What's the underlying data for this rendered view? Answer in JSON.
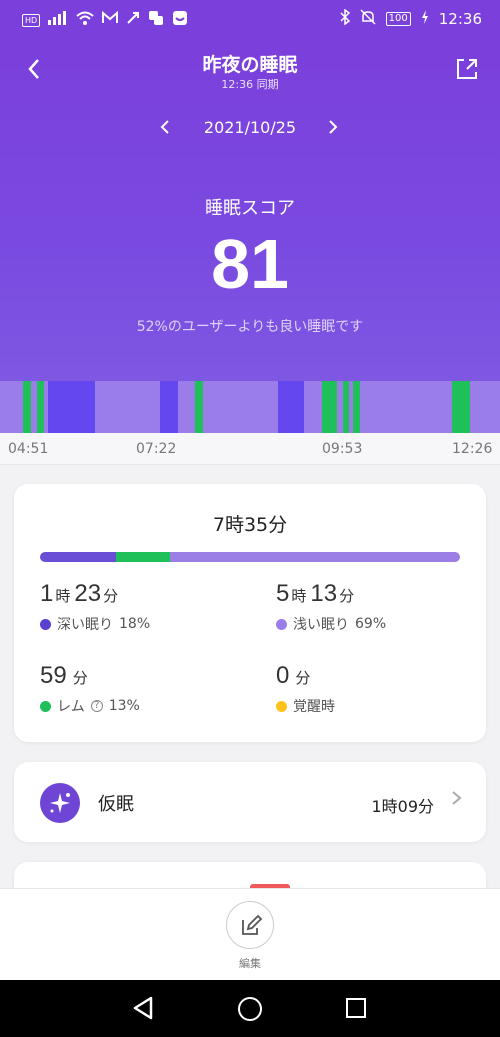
{
  "status_bar": {
    "hd": "HD",
    "battery": "100",
    "time": "12:36"
  },
  "header": {
    "title": "昨夜の睡眠",
    "sync": "12:36 同期",
    "date": "2021/10/25",
    "score_label": "睡眠スコア",
    "score": "81",
    "score_sub": "52%のユーザーよりも良い睡眠です"
  },
  "timeline": {
    "labels": [
      "04:51",
      "07:22",
      "09:53",
      "12:26"
    ],
    "colors": {
      "light": "#9a7de8",
      "deep": "#6447ef",
      "rem": "#1fbf5a"
    },
    "segments": [
      {
        "stage": "rem",
        "start": 0.046,
        "end": 0.062
      },
      {
        "stage": "rem",
        "start": 0.074,
        "end": 0.088
      },
      {
        "stage": "deep",
        "start": 0.096,
        "end": 0.19
      },
      {
        "stage": "deep",
        "start": 0.32,
        "end": 0.356
      },
      {
        "stage": "rem",
        "start": 0.39,
        "end": 0.406
      },
      {
        "stage": "deep",
        "start": 0.556,
        "end": 0.608
      },
      {
        "stage": "rem",
        "start": 0.644,
        "end": 0.674
      },
      {
        "stage": "rem",
        "start": 0.686,
        "end": 0.698
      },
      {
        "stage": "rem",
        "start": 0.706,
        "end": 0.72
      },
      {
        "stage": "rem",
        "start": 0.904,
        "end": 0.94
      }
    ]
  },
  "summary": {
    "total": "7時35分",
    "bar": [
      {
        "stage": "deep",
        "pct": 18,
        "color": "#6a4fd6"
      },
      {
        "stage": "rem",
        "pct": 13,
        "color": "#1fbf5a"
      },
      {
        "stage": "light",
        "pct": 69,
        "color": "#9b7fe6"
      }
    ],
    "deep": {
      "h": "1",
      "h_unit": "時",
      "m": "23",
      "m_unit": "分",
      "label": "深い眠り",
      "pct": "18%",
      "color": "#5b3fd0"
    },
    "light": {
      "h": "5",
      "h_unit": "時",
      "m": "13",
      "m_unit": "分",
      "label": "浅い眠り",
      "pct": "69%",
      "color": "#9a7de8"
    },
    "rem": {
      "m": "59",
      "m_unit": "分",
      "label": "レム",
      "pct": "13%",
      "color": "#1fbf5a"
    },
    "awake": {
      "m": "0",
      "m_unit": "分",
      "label": "覚醒時",
      "color": "#ffc21a"
    }
  },
  "nap": {
    "label": "仮眠",
    "value": "1時09分"
  },
  "edit": {
    "label": "編集"
  }
}
